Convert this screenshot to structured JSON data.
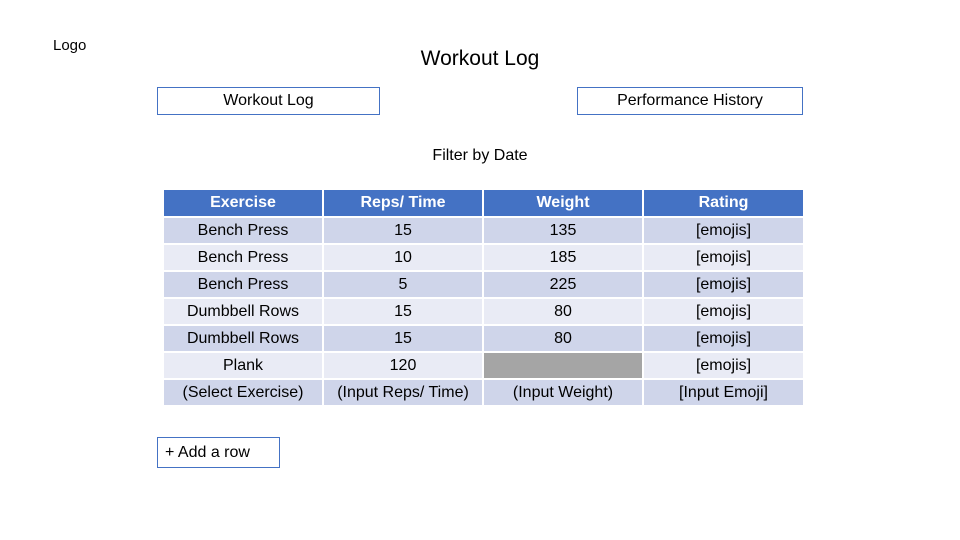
{
  "logo": "Logo",
  "title": "Workout Log",
  "nav": {
    "workout_log": "Workout Log",
    "performance_history": "Performance History"
  },
  "filter_label": "Filter by Date",
  "table": {
    "headers": [
      "Exercise",
      "Reps/ Time",
      "Weight",
      "Rating"
    ],
    "rows": [
      [
        "Bench Press",
        "15",
        "135",
        "[emojis]"
      ],
      [
        "Bench Press",
        "10",
        "185",
        "[emojis]"
      ],
      [
        "Bench Press",
        "5",
        "225",
        "[emojis]"
      ],
      [
        "Dumbbell Rows",
        "15",
        "80",
        "[emojis]"
      ],
      [
        "Dumbbell Rows",
        "15",
        "80",
        "[emojis]"
      ],
      [
        "Plank",
        "120",
        "",
        "[emojis]"
      ]
    ],
    "input_row": [
      "(Select Exercise)",
      "(Input Reps/ Time)",
      "(Input Weight)",
      "[Input Emoji]"
    ]
  },
  "add_row_label": "+ Add a row",
  "colors": {
    "accent": "#4472c4",
    "row_dark": "#cfd5ea",
    "row_light": "#e9ebf5",
    "disabled_cell": "#a5a5a5"
  }
}
